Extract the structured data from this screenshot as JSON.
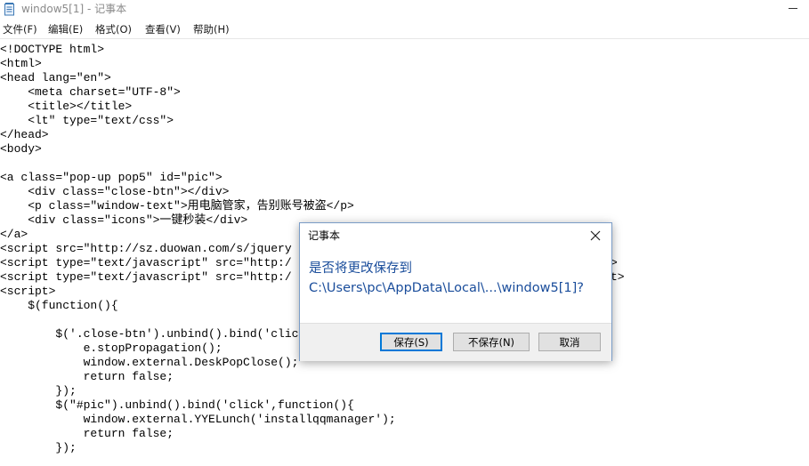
{
  "window": {
    "title": "window5[1] - 记事本"
  },
  "menu": {
    "items": [
      {
        "label": "文件(F)"
      },
      {
        "label": "编辑(E)"
      },
      {
        "label": "格式(O)"
      },
      {
        "label": "查看(V)"
      },
      {
        "label": "帮助(H)"
      }
    ]
  },
  "editor": {
    "lines": [
      "<!DOCTYPE html>",
      "<html>",
      "<head lang=\"en\">",
      "    <meta charset=\"UTF-8\">",
      "    <title></title>",
      "    <lt\" type=\"text/css\">",
      "</head>",
      "<body>",
      "",
      "<a class=\"pop-up pop5\" id=\"pic\">",
      "    <div class=\"close-btn\"></div>",
      "    <p class=\"window-text\">用电脑管家，告别账号被盗</p>",
      "    <div class=\"icons\">一键秒装</div>",
      "</a>",
      "<script src=\"http://sz.duowan.com/s/jquery",
      "<script type=\"text/javascript\" src=\"http:/",
      "<script type=\"text/javascript\" src=\"http:/",
      "<script>",
      "    $(function(){",
      "",
      "        $('.close-btn').unbind().bind('clic",
      "            e.stopPropagation();",
      "            window.external.DeskPopClose();",
      "            return false;",
      "        });",
      "        $(\"#pic\").unbind().bind('click',function(){",
      "            window.external.YYELunch('installqqmanager');",
      "            return false;",
      "        });"
    ],
    "overflow_fragments": [
      {
        "line": 15,
        "text": ">"
      },
      {
        "line": 16,
        "text": "t>"
      }
    ]
  },
  "dialog": {
    "title": "记事本",
    "message_line1": "是否将更改保存到",
    "message_line2": "C:\\Users\\pc\\AppData\\Local\\...\\window5[1]?",
    "buttons": {
      "save": "保存(S)",
      "dont_save": "不保存(N)",
      "cancel": "取消"
    }
  },
  "colors": {
    "dialog_message": "#1a4d9b",
    "default_button_border": "#0078d7",
    "title_text": "#8a8a8a"
  },
  "icons": {
    "app": "notepad-icon",
    "close": "close-icon",
    "minimize": "minimize-icon"
  }
}
